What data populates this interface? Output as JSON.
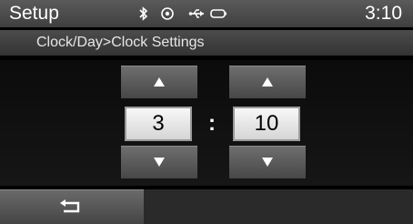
{
  "status_bar": {
    "title": "Setup",
    "time": "3:10",
    "icons": [
      "bluetooth-icon",
      "record-icon",
      "usb-icon",
      "battery-icon"
    ]
  },
  "breadcrumb": "Clock/Day>Clock Settings",
  "time_setting": {
    "hour": "3",
    "separator": ":",
    "minute": "10"
  },
  "colors": {
    "bar_bg": "#4a4a4a",
    "button_bg": "#5c5c5c",
    "value_bg": "#efefef"
  }
}
